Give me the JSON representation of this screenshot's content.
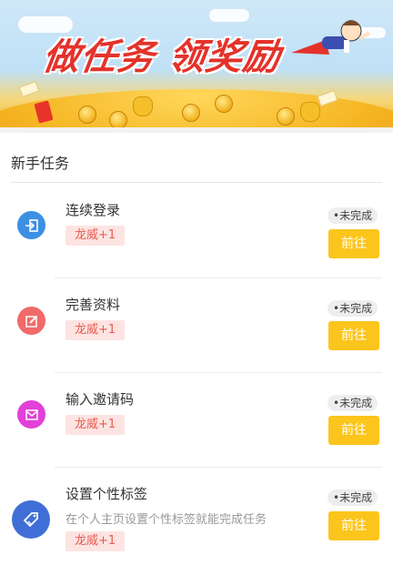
{
  "banner": {
    "title": "做任务 领奖励"
  },
  "section": {
    "title": "新手任务"
  },
  "tasks": [
    {
      "name": "连续登录",
      "reward": "龙威+1",
      "status": "•未完成",
      "button": "前往",
      "icon": "login-icon",
      "icon_color": "#3d8fe3"
    },
    {
      "name": "完善资料",
      "reward": "龙威+1",
      "status": "•未完成",
      "button": "前往",
      "icon": "edit-icon",
      "icon_color": "#f06a6a"
    },
    {
      "name": "输入邀请码",
      "reward": "龙威+1",
      "status": "•未完成",
      "button": "前往",
      "icon": "mail-icon",
      "icon_color": "#e240d8"
    },
    {
      "name": "设置个性标签",
      "desc": "在个人主页设置个性标签就能完成任务",
      "reward": "龙威+1",
      "status": "•未完成",
      "button": "前往",
      "icon": "tag-icon",
      "icon_color": "#3f6fd6"
    }
  ],
  "colors": {
    "accent": "#fbc51c",
    "reward_bg": "#fde4e2",
    "reward_text": "#e85b50"
  }
}
